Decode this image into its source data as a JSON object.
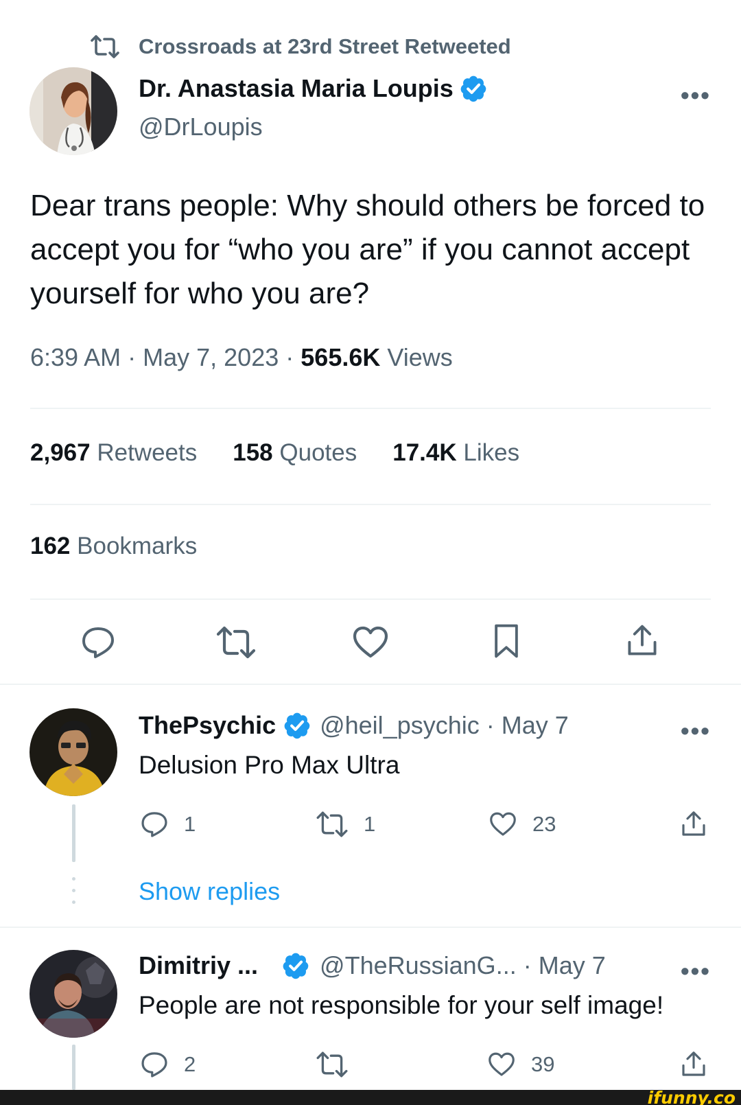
{
  "retweet_header": {
    "text": "Crossroads at 23rd Street Retweeted"
  },
  "author": {
    "name": "Dr. Anastasia Maria Loupis",
    "handle": "@DrLoupis"
  },
  "tweet": {
    "text": "Dear trans people: Why should others be forced to accept you for “who you are” if you cannot accept yourself for who you are?",
    "time": "6:39 AM",
    "date": "May 7, 2023",
    "views_count": "565.6K",
    "views_label": "Views",
    "separator": "·"
  },
  "stats": {
    "retweets_count": "2,967",
    "retweets_label": "Retweets",
    "quotes_count": "158",
    "quotes_label": "Quotes",
    "likes_count": "17.4K",
    "likes_label": "Likes",
    "bookmarks_count": "162",
    "bookmarks_label": "Bookmarks"
  },
  "more_label": "•••",
  "replies": [
    {
      "name": "ThePsychic",
      "handle": "@heil_psychic",
      "date": "May 7",
      "text": "Delusion Pro Max Ultra",
      "reply_count": "1",
      "retweet_count": "1",
      "like_count": "23"
    },
    {
      "name": "Dimitriy ...",
      "handle": "@TheRussianG...",
      "date": "May 7",
      "text": "People are not responsible for your self image!",
      "reply_count": "2",
      "retweet_count": "",
      "like_count": "39"
    }
  ],
  "show_replies_label": "Show replies",
  "watermark": "ifunny.co",
  "colors": {
    "accent": "#1d9bf0",
    "text": "#0f1419",
    "muted": "#536471",
    "divider": "#eff3f4"
  }
}
